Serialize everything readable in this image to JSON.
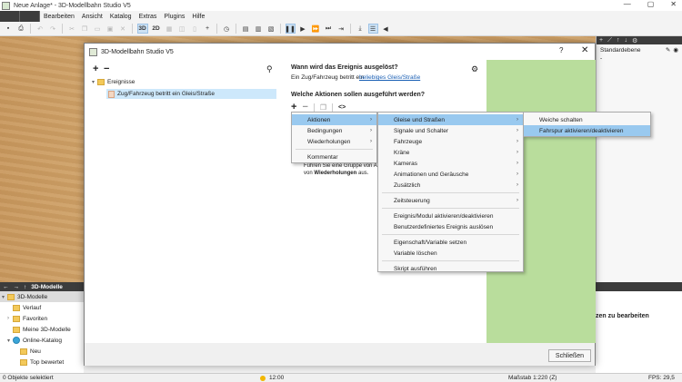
{
  "app": {
    "window_title": "Neue Anlage* - 3D-Modellbahn Studio V5",
    "window_controls": [
      "—",
      "▢",
      "✕"
    ]
  },
  "menubar": {
    "items": [
      "Bearbeiten",
      "Ansicht",
      "Katalog",
      "Extras",
      "Plugins",
      "Hilfe"
    ]
  },
  "toolbar": {
    "view_3d": "3D",
    "view_2d": "2D"
  },
  "right_panel": {
    "layer_name": "Standardebene",
    "layer_sub": "-"
  },
  "models_panel": {
    "title": "3D-Modelle",
    "tree": [
      {
        "label": "3D-Modelle",
        "icon": "folder-icon",
        "level": 0,
        "expanded": true
      },
      {
        "label": "Verlauf",
        "icon": "folder-icon",
        "level": 1
      },
      {
        "label": "Favoriten",
        "icon": "folder-icon",
        "level": 1,
        "has_children": true
      },
      {
        "label": "Meine 3D-Modelle",
        "icon": "folder-icon",
        "level": 1
      },
      {
        "label": "Online-Katalog",
        "icon": "globe-icon",
        "level": 1,
        "expanded": true
      },
      {
        "label": "Neu",
        "icon": "folder-icon",
        "level": 2
      },
      {
        "label": "Top bewertet",
        "icon": "folder-icon",
        "level": 2
      }
    ]
  },
  "bottom_right": {
    "hint": "zen zu bearbeiten"
  },
  "statusbar": {
    "selection": "0 Objekte selektiert",
    "time": "12:00",
    "scale": "Maßstab 1:220 (Z)",
    "fps": "FPS: 29,5"
  },
  "dialog": {
    "title": "3D-Modellbahn Studio V5",
    "help": "?",
    "close": "✕",
    "tree_root": "Ereignisse",
    "event_item": "Zug/Fahrzeug betritt ein Gleis/Straße",
    "trigger_heading": "Wann wird das Ereignis ausgelöst?",
    "trigger_text": "Ein Zug/Fahrzeug betritt ein",
    "trigger_link": "beliebiges Gleis/Straße",
    "actions_heading": "Welche Aktionen sollen ausgeführt werden?",
    "code_icon_label": "<>",
    "info_line1": "Führen Sie eine Gruppe von Ak",
    "info_line2_pre": "von",
    "info_line2_bold": "Wiederholungen",
    "info_line2_post": "aus.",
    "close_button": "Schließen"
  },
  "menus": {
    "level1": [
      {
        "label": "Aktionen",
        "submenu": true,
        "highlighted": true
      },
      {
        "label": "Bedingungen",
        "submenu": true
      },
      {
        "label": "Wiederholungen",
        "submenu": true
      },
      {
        "separator": true
      },
      {
        "label": "Kommentar"
      }
    ],
    "level2": [
      {
        "label": "Gleise und Straßen",
        "submenu": true,
        "highlighted": true
      },
      {
        "label": "Signale und Schalter",
        "submenu": true
      },
      {
        "label": "Fahrzeuge",
        "submenu": true
      },
      {
        "label": "Kräne",
        "submenu": true
      },
      {
        "label": "Kameras",
        "submenu": true
      },
      {
        "label": "Animationen und Geräusche",
        "submenu": true
      },
      {
        "label": "Zusätzlich",
        "submenu": true
      },
      {
        "separator": true
      },
      {
        "label": "Zeitsteuerung",
        "submenu": true
      },
      {
        "separator": true
      },
      {
        "label": "Ereignis/Modul aktivieren/deaktivieren"
      },
      {
        "label": "Benutzerdefiniertes Ereignis auslösen"
      },
      {
        "separator": true
      },
      {
        "label": "Eigenschaft/Variable setzen"
      },
      {
        "label": "Variable löschen"
      },
      {
        "separator": true
      },
      {
        "label": "Skript ausführen"
      }
    ],
    "level3": [
      {
        "label": "Weiche schalten"
      },
      {
        "label": "Fahrspur aktivieren/deaktivieren",
        "highlighted": true
      }
    ]
  }
}
